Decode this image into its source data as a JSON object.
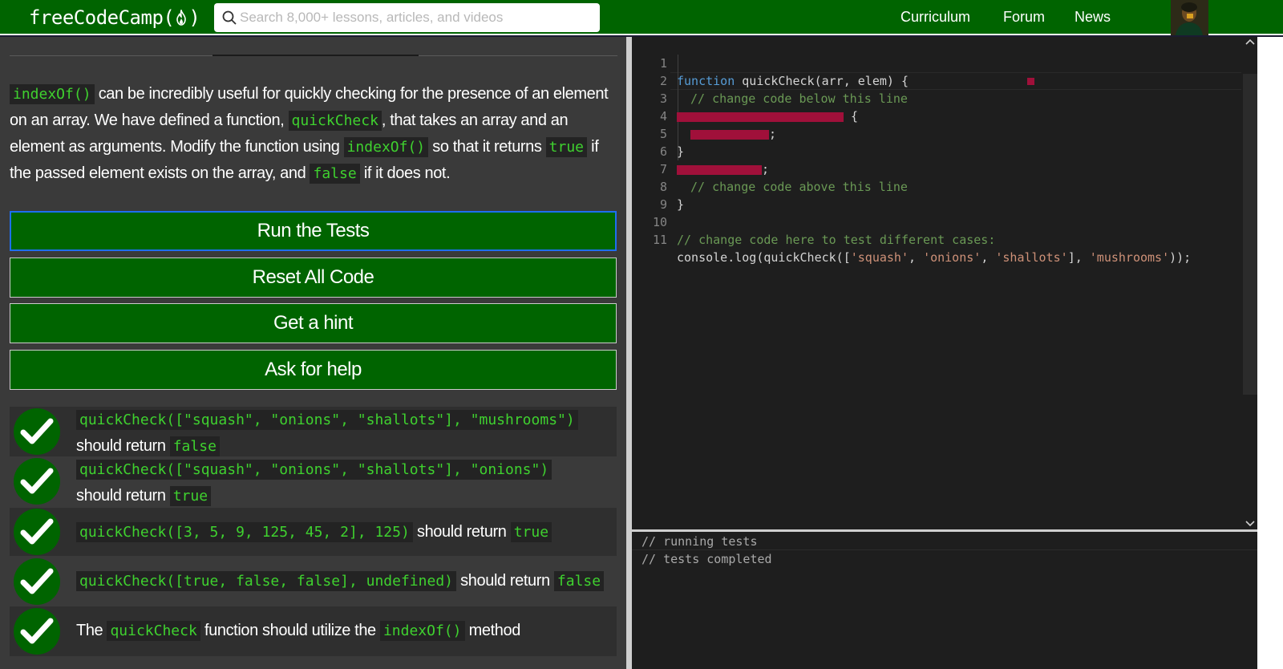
{
  "nav": {
    "logo_text_left": "freeCodeCamp(",
    "logo_text_right": ")",
    "search_placeholder": "Search 8,000+ lessons, articles, and videos",
    "links": [
      "Curriculum",
      "Forum",
      "News"
    ]
  },
  "description": {
    "p1_code1": "indexOf()",
    "p1_t1": " can be incredibly useful for quickly checking for the presence of an element on an array. We have defined a function, ",
    "p1_code2": "quickCheck",
    "p1_t2": ", that takes an array and an element as arguments. Modify the function using ",
    "p1_code3": "indexOf()",
    "p1_t3": " so that it returns ",
    "p1_code4": "true",
    "p1_t4": " if the passed element exists on the array, and ",
    "p1_code5": "false",
    "p1_t5": " if it does not."
  },
  "buttons": {
    "run": "Run the Tests",
    "reset": "Reset All Code",
    "hint": "Get a hint",
    "help": "Ask for help"
  },
  "tests": [
    {
      "code": "quickCheck([\"squash\", \"onions\", \"shallots\"], \"mushrooms\")",
      "mid": "should return",
      "code2": "false"
    },
    {
      "code": "quickCheck([\"squash\", \"onions\", \"shallots\"], \"onions\")",
      "mid": "should return",
      "code2": "true"
    },
    {
      "code": "quickCheck([3, 5, 9, 125, 45, 2], 125)",
      "mid": "should return",
      "code2": "true"
    },
    {
      "code": "quickCheck([true, false, false], undefined)",
      "mid": "should return",
      "code2": "false"
    },
    {
      "pre": "The",
      "code": "quickCheck",
      "mid": "function should utilize the",
      "code2": "indexOf()",
      "post": "method"
    }
  ],
  "editor": {
    "line_numbers": [
      "1",
      "2",
      "3",
      "4",
      "5",
      "6",
      "7",
      "8",
      "9",
      "10",
      "11"
    ],
    "l1_kw": "function",
    "l1_rest": " quickCheck(arr, elem) {",
    "l2": "// change code below this line",
    "l3_rest": " {",
    "l4_rest": ";",
    "l5": "}",
    "l6_rest": ";",
    "l7": "// change code above this line",
    "l8": "}",
    "l10": "// change code here to test different cases:",
    "l11_a": "console.log(quickCheck([",
    "l11_s1": "'squash'",
    "l11_c1": ", ",
    "l11_s2": "'onions'",
    "l11_c2": ", ",
    "l11_s3": "'shallots'",
    "l11_b": "], ",
    "l11_s4": "'mushrooms'",
    "l11_end": "));"
  },
  "output": {
    "lines": [
      "// running tests",
      "// tests completed"
    ]
  }
}
